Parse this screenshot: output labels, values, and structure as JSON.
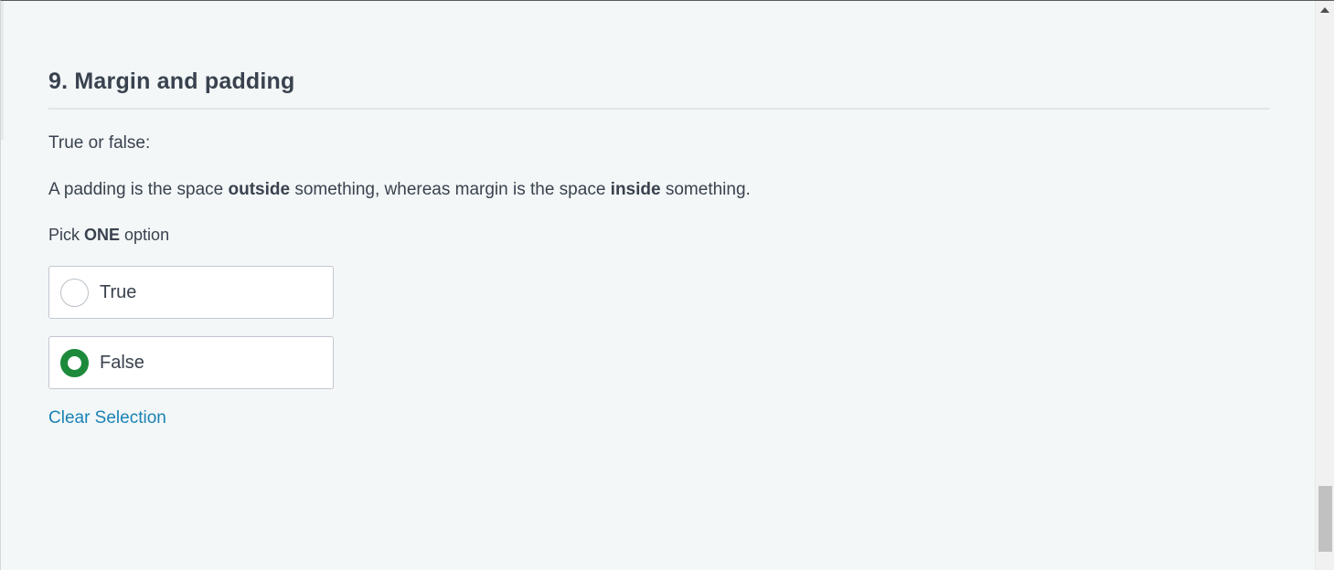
{
  "question": {
    "title": "9. Margin and padding",
    "prompt": "True or false:",
    "statement": {
      "part1": "A padding is the space ",
      "bold1": "outside",
      "part2": " something, whereas margin is the space ",
      "bold2": "inside",
      "part3": " something."
    },
    "instruction": {
      "prefix": "Pick ",
      "bold": "ONE",
      "suffix": " option"
    },
    "options": [
      {
        "label": "True",
        "selected": false
      },
      {
        "label": "False",
        "selected": true
      }
    ],
    "clear_label": "Clear Selection"
  },
  "colors": {
    "selected_radio": "#1c8a3a",
    "link": "#1a82b5",
    "background": "#f3f7f8"
  },
  "icons": {
    "scroll_up": "triangle-up"
  }
}
